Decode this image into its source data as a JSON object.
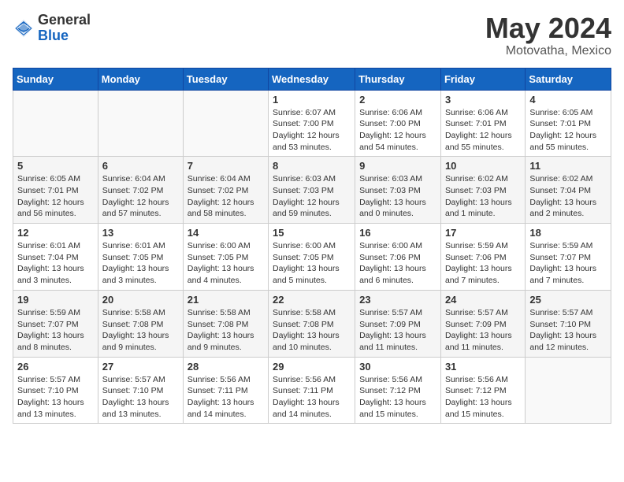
{
  "header": {
    "logo_general": "General",
    "logo_blue": "Blue",
    "month": "May 2024",
    "location": "Motovatha, Mexico"
  },
  "weekdays": [
    "Sunday",
    "Monday",
    "Tuesday",
    "Wednesday",
    "Thursday",
    "Friday",
    "Saturday"
  ],
  "weeks": [
    [
      {
        "day": "",
        "info": ""
      },
      {
        "day": "",
        "info": ""
      },
      {
        "day": "",
        "info": ""
      },
      {
        "day": "1",
        "info": "Sunrise: 6:07 AM\nSunset: 7:00 PM\nDaylight: 12 hours and 53 minutes."
      },
      {
        "day": "2",
        "info": "Sunrise: 6:06 AM\nSunset: 7:00 PM\nDaylight: 12 hours and 54 minutes."
      },
      {
        "day": "3",
        "info": "Sunrise: 6:06 AM\nSunset: 7:01 PM\nDaylight: 12 hours and 55 minutes."
      },
      {
        "day": "4",
        "info": "Sunrise: 6:05 AM\nSunset: 7:01 PM\nDaylight: 12 hours and 55 minutes."
      }
    ],
    [
      {
        "day": "5",
        "info": "Sunrise: 6:05 AM\nSunset: 7:01 PM\nDaylight: 12 hours and 56 minutes."
      },
      {
        "day": "6",
        "info": "Sunrise: 6:04 AM\nSunset: 7:02 PM\nDaylight: 12 hours and 57 minutes."
      },
      {
        "day": "7",
        "info": "Sunrise: 6:04 AM\nSunset: 7:02 PM\nDaylight: 12 hours and 58 minutes."
      },
      {
        "day": "8",
        "info": "Sunrise: 6:03 AM\nSunset: 7:03 PM\nDaylight: 12 hours and 59 minutes."
      },
      {
        "day": "9",
        "info": "Sunrise: 6:03 AM\nSunset: 7:03 PM\nDaylight: 13 hours and 0 minutes."
      },
      {
        "day": "10",
        "info": "Sunrise: 6:02 AM\nSunset: 7:03 PM\nDaylight: 13 hours and 1 minute."
      },
      {
        "day": "11",
        "info": "Sunrise: 6:02 AM\nSunset: 7:04 PM\nDaylight: 13 hours and 2 minutes."
      }
    ],
    [
      {
        "day": "12",
        "info": "Sunrise: 6:01 AM\nSunset: 7:04 PM\nDaylight: 13 hours and 3 minutes."
      },
      {
        "day": "13",
        "info": "Sunrise: 6:01 AM\nSunset: 7:05 PM\nDaylight: 13 hours and 3 minutes."
      },
      {
        "day": "14",
        "info": "Sunrise: 6:00 AM\nSunset: 7:05 PM\nDaylight: 13 hours and 4 minutes."
      },
      {
        "day": "15",
        "info": "Sunrise: 6:00 AM\nSunset: 7:05 PM\nDaylight: 13 hours and 5 minutes."
      },
      {
        "day": "16",
        "info": "Sunrise: 6:00 AM\nSunset: 7:06 PM\nDaylight: 13 hours and 6 minutes."
      },
      {
        "day": "17",
        "info": "Sunrise: 5:59 AM\nSunset: 7:06 PM\nDaylight: 13 hours and 7 minutes."
      },
      {
        "day": "18",
        "info": "Sunrise: 5:59 AM\nSunset: 7:07 PM\nDaylight: 13 hours and 7 minutes."
      }
    ],
    [
      {
        "day": "19",
        "info": "Sunrise: 5:59 AM\nSunset: 7:07 PM\nDaylight: 13 hours and 8 minutes."
      },
      {
        "day": "20",
        "info": "Sunrise: 5:58 AM\nSunset: 7:08 PM\nDaylight: 13 hours and 9 minutes."
      },
      {
        "day": "21",
        "info": "Sunrise: 5:58 AM\nSunset: 7:08 PM\nDaylight: 13 hours and 9 minutes."
      },
      {
        "day": "22",
        "info": "Sunrise: 5:58 AM\nSunset: 7:08 PM\nDaylight: 13 hours and 10 minutes."
      },
      {
        "day": "23",
        "info": "Sunrise: 5:57 AM\nSunset: 7:09 PM\nDaylight: 13 hours and 11 minutes."
      },
      {
        "day": "24",
        "info": "Sunrise: 5:57 AM\nSunset: 7:09 PM\nDaylight: 13 hours and 11 minutes."
      },
      {
        "day": "25",
        "info": "Sunrise: 5:57 AM\nSunset: 7:10 PM\nDaylight: 13 hours and 12 minutes."
      }
    ],
    [
      {
        "day": "26",
        "info": "Sunrise: 5:57 AM\nSunset: 7:10 PM\nDaylight: 13 hours and 13 minutes."
      },
      {
        "day": "27",
        "info": "Sunrise: 5:57 AM\nSunset: 7:10 PM\nDaylight: 13 hours and 13 minutes."
      },
      {
        "day": "28",
        "info": "Sunrise: 5:56 AM\nSunset: 7:11 PM\nDaylight: 13 hours and 14 minutes."
      },
      {
        "day": "29",
        "info": "Sunrise: 5:56 AM\nSunset: 7:11 PM\nDaylight: 13 hours and 14 minutes."
      },
      {
        "day": "30",
        "info": "Sunrise: 5:56 AM\nSunset: 7:12 PM\nDaylight: 13 hours and 15 minutes."
      },
      {
        "day": "31",
        "info": "Sunrise: 5:56 AM\nSunset: 7:12 PM\nDaylight: 13 hours and 15 minutes."
      },
      {
        "day": "",
        "info": ""
      }
    ]
  ]
}
